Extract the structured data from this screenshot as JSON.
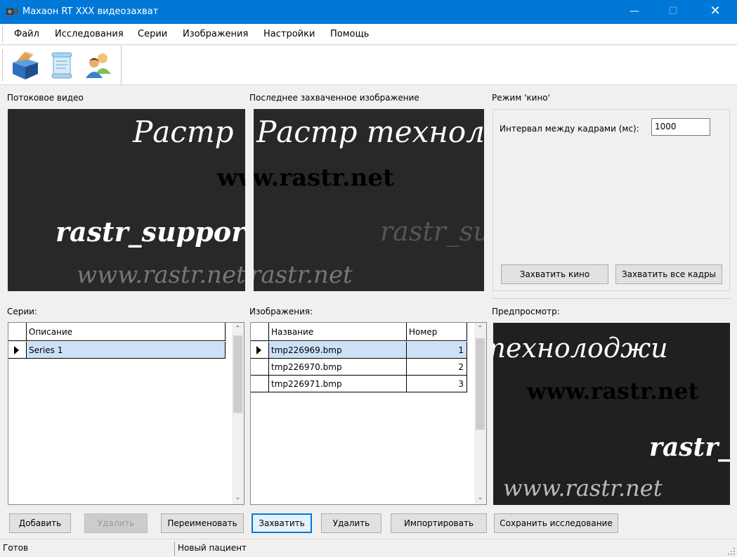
{
  "window": {
    "title": "Махаон RT XXX видеозахват",
    "minimize": "—",
    "maximize": "☐",
    "close": "✕"
  },
  "menu": [
    "Файл",
    "Исследования",
    "Серии",
    "Изображения",
    "Настройки",
    "Помощь"
  ],
  "toolbar": {
    "icons": [
      "open-box-icon",
      "document-scroll-icon",
      "patients-icon"
    ]
  },
  "panels": {
    "stream_label": "Потоковое видео",
    "last_capture_label": "Последнее захваченное изображение",
    "cinema_label": "Режим 'кино'",
    "series_label": "Серии:",
    "images_label": "Изображения:",
    "preview_label": "Предпросмотр:"
  },
  "video_text": {
    "line1": "Растр технолоджи",
    "line2": "www.rastr.net",
    "line3": "rastr_support@rastr.net",
    "line4": "www.rastr.net"
  },
  "cinema": {
    "interval_label": "Интервал между кадрами (мс):",
    "interval_value": "1000",
    "capture_movie": "Захватить кино",
    "capture_all": "Захватить все кадры"
  },
  "series_grid": {
    "columns": [
      "Описание"
    ],
    "rows": [
      {
        "description": "Series 1",
        "selected": true
      }
    ]
  },
  "images_grid": {
    "columns": [
      "Название",
      "Номер"
    ],
    "rows": [
      {
        "name": "tmp226969.bmp",
        "number": "1",
        "selected": true
      },
      {
        "name": "tmp226970.bmp",
        "number": "2",
        "selected": false
      },
      {
        "name": "tmp226971.bmp",
        "number": "3",
        "selected": false
      }
    ]
  },
  "buttons": {
    "add": "Добавить",
    "delete_series": "Удалить",
    "rename": "Переименовать",
    "capture": "Захватить",
    "delete_image": "Удалить",
    "import": "Импортировать",
    "save_study": "Сохранить исследование"
  },
  "status": {
    "state": "Готов",
    "patient": "Новый пациент"
  },
  "colors": {
    "titlebar": "#0078d7",
    "video_bg": "#282828",
    "selection": "#cce0f7"
  }
}
